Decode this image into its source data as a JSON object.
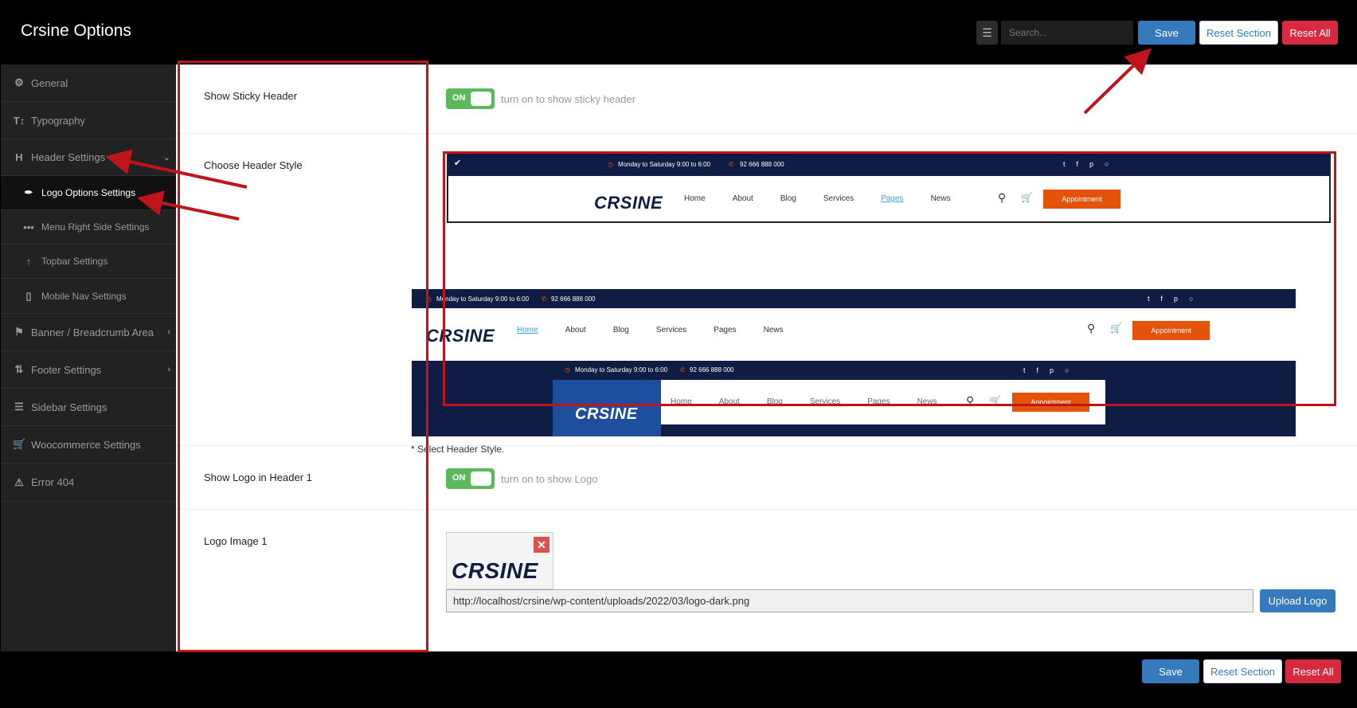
{
  "app": {
    "title": "Crsine Options"
  },
  "toolbar": {
    "search_placeholder": "Search...",
    "save": "Save",
    "reset_section": "Reset Section",
    "reset_all": "Reset All"
  },
  "sidebar": {
    "items": [
      {
        "label": "General",
        "icon": "gears-icon"
      },
      {
        "label": "Typography",
        "icon": "text-height-icon"
      },
      {
        "label": "Header Settings",
        "icon": "header-icon"
      },
      {
        "label": "Logo Options Settings",
        "icon": "brush-icon"
      },
      {
        "label": "Menu Right Side Settings",
        "icon": "ellipsis-icon"
      },
      {
        "label": "Topbar Settings",
        "icon": "arrow-up-icon"
      },
      {
        "label": "Mobile Nav Settings",
        "icon": "mobile-icon"
      },
      {
        "label": "Banner / Breadcrumb Area",
        "icon": "flag-icon"
      },
      {
        "label": "Footer Settings",
        "icon": "sort-icon"
      },
      {
        "label": "Sidebar Settings",
        "icon": "bars-icon"
      },
      {
        "label": "Woocommerce Settings",
        "icon": "cart-icon"
      },
      {
        "label": "Error 404",
        "icon": "warning-icon"
      }
    ]
  },
  "fields": {
    "sticky": {
      "label": "Show Sticky Header",
      "toggle": "ON",
      "desc": "turn on to show sticky header"
    },
    "header_style": {
      "label": "Choose Header Style",
      "note": "* Select Header Style."
    },
    "show_logo": {
      "label": "Show Logo in Header 1",
      "toggle": "ON",
      "desc": "turn on to show Logo"
    },
    "logo_image": {
      "label": "Logo Image 1",
      "url": "http://localhost/crsine/wp-content/uploads/2022/03/logo-dark.png",
      "upload": "Upload Logo"
    }
  },
  "preview": {
    "topbar_hours": "Monday to Saturday 9:00 to 6:00",
    "topbar_phone": "92 666 888 000",
    "logo": "CRSINE",
    "nav": [
      "Home",
      "About",
      "Blog",
      "Services",
      "Pages",
      "News"
    ],
    "cta": "Appointment"
  },
  "colors": {
    "accent": "#3679bd",
    "danger": "#d7293f",
    "toggle_on": "#5cb85c",
    "annotation": "#c0141b",
    "cta": "#e5530a"
  }
}
